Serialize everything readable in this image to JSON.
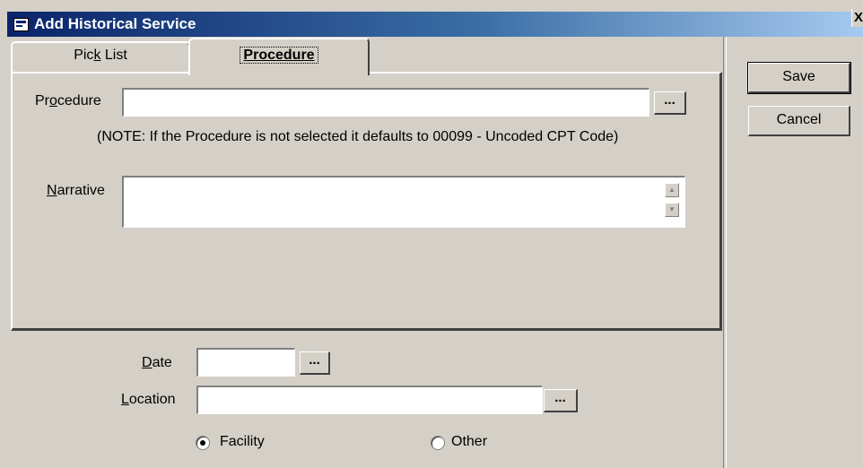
{
  "window": {
    "title": "Add Historical Service",
    "close_glyph": "X",
    "icon": "form-icon"
  },
  "tabs": [
    {
      "label_pre": "Pic",
      "label_key": "k",
      "label_post": " List",
      "active": false
    },
    {
      "label": "Procedure",
      "active": true
    }
  ],
  "procedure_tab": {
    "procedure_label_pre": "Pr",
    "procedure_label_key": "o",
    "procedure_label_post": "cedure",
    "procedure_value": "",
    "browse_glyph": "...",
    "note": "(NOTE: If the Procedure is not selected it defaults to 00099 - Uncoded CPT Code)",
    "narrative_label_key": "N",
    "narrative_label_post": "arrative",
    "narrative_value": ""
  },
  "bottom": {
    "date_label_key": "D",
    "date_label_post": "ate",
    "date_value": "",
    "location_label_key": "L",
    "location_label_post": "ocation",
    "location_value": "",
    "browse_glyph": "...",
    "radio_facility": "Facility",
    "radio_other": "Other",
    "selected": "Facility"
  },
  "buttons": {
    "save": "Save",
    "cancel": "Cancel"
  },
  "colors": {
    "face": "#d4d0c8",
    "title_start": "#0a246a",
    "title_end": "#a6caf0"
  }
}
